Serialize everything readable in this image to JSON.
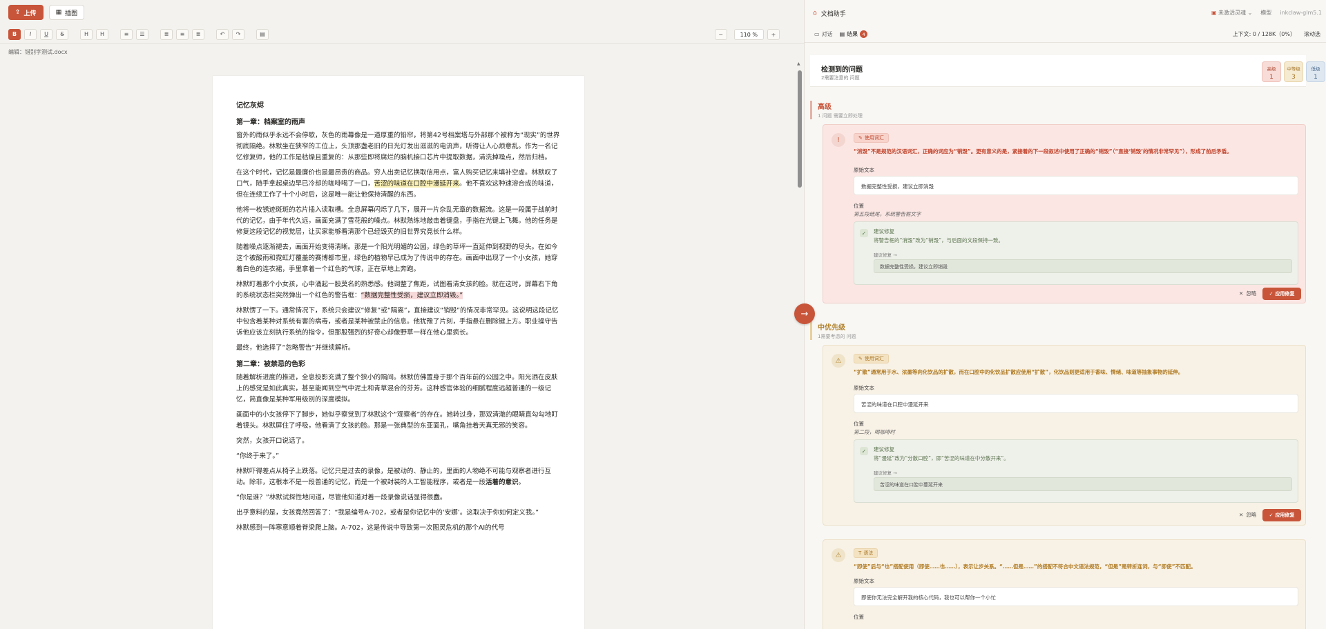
{
  "editor": {
    "upload_label": "上传",
    "illustrate_label": "插图",
    "zoom": "110 %",
    "edit_label": "编辑：",
    "filename": "错别字测试.docx",
    "doc": {
      "title": "记忆灰烬",
      "chapter1": "第一章：档案室的雨声",
      "p1": "窗外的雨似乎永远不会停歇，灰色的雨幕像是一道厚重的铅帘，将第42号档案塔与外部那个被称为“现实”的世界彻底隔绝。林默坐在狭窄的工位上，头顶那盏老旧的日光灯发出滋滋的电流声，听得让人心烦意乱。作为一名记忆修复师，他的工作是枯燥且重复的：从那些即将腐烂的脑机接口芯片中提取数据，清洗掉噪点，然后归档。",
      "p2a": "在这个时代，记忆是最廉价也是最昂贵的商品。穷人出卖记忆换取信用点，富人购买记忆来填补空虚。林默叹了口气，随手拿起桌边早已冷却的咖啡喝了一口，",
      "p2hl": "苦涩的味道在口腔中漫延开来",
      "p2b": "。他不喜欢这种速溶合成的味道，但在连续工作了十个小时后，这是唯一能让他保持清醒的东西。",
      "p3": "他将一枚锈迹斑斑的芯片插入读取槽。全息屏幕闪烁了几下，展开一片杂乱无章的数据流。这是一段属于战前时代的记忆，由于年代久远，画面充满了雪花般的噪点。林默熟练地敲击着键盘，手指在光键上飞舞。他的任务是修复这段记忆的视觉层，让买家能够看清那个已经毁灭的旧世界究竟长什么样。",
      "p4": "随着噪点逐渐褪去，画面开始变得清晰。那是一个阳光明媚的公园，绿色的草坪一直延伸到视野的尽头。在如今这个被酸雨和霓虹灯覆盖的赛博都市里，绿色的植物早已成为了传说中的存在。画面中出现了一个小女孩，她穿着白色的连衣裙，手里拿着一个红色的气球，正在草地上奔跑。",
      "p5a": "林默盯着那个小女孩，心中涌起一股莫名的熟悉感。他调整了焦距，试图看清女孩的脸。就在这时，屏幕右下角的系统状态栏突然弹出一个红色的警告框：",
      "p5hl": "“数据完整性受损，建议立即消毁。”",
      "p6": "林默愣了一下。通常情况下，系统只会建议“修复”或“隔离”，直接建议“销毁”的情况非常罕见。这说明这段记忆中包含着某种对系统有害的病毒，或者是某种被禁止的信息。他犹豫了片刻，手指悬在删除键上方。职业操守告诉他应该立刻执行系统的指令，但那股强烈的好奇心却像野草一样在他心里疯长。",
      "p7": "最终，他选择了“忽略警告”并继续解析。",
      "chapter2": "第二章：被禁忌的色彩",
      "p8": "随着解析进度的推进，全息投影充满了整个狭小的隔间。林默仿佛置身于那个百年前的公园之中。阳光洒在皮肤上的感觉是如此真实，甚至能闻到空气中泥土和青草混合的芬芳。这种感官体验的细腻程度远超普通的一级记忆，简直像是某种军用级别的深度模拟。",
      "p9": "画面中的小女孩停下了脚步，她似乎察觉到了林默这个“观察者”的存在。她转过身，那双清澈的眼睛直勾勾地盯着镜头。林默屏住了呼吸，他看清了女孩的脸。那是一张典型的东亚面孔，嘴角挂着天真无邪的笑容。",
      "p10": "突然，女孩开口说话了。",
      "p11": "“你终于来了。”",
      "p12a": "林默吓得差点从椅子上跌落。记忆只是过去的录像，是被动的、静止的，里面的人物绝不可能与观察者进行互动。除非，这根本不是一段普通的记忆，而是一个被封装的人工智能程序，或者是一段",
      "p12b": "活着的意识",
      "p12c": "。",
      "p13": "“你是谁？”林默试探性地问道，尽管他知道对着一段录像说话显得很蠢。",
      "p14": "出乎意料的是，女孩竟然回答了：“我是编号A-702，或者是你记忆中的‘安娜’。这取决于你如何定义我。”",
      "p15": "林默感到一阵寒意顺着脊梁爬上脑。A-702，这是传说中导致第一次图灵危机的那个AI的代号"
    }
  },
  "panel": {
    "title": "文档助手",
    "status": "未激活灵魂",
    "model_label": "模型",
    "model_name": "inkclaw-glm5.1",
    "tab_chat": "对话",
    "tab_results": "结果",
    "results_count": "4",
    "context": "上下文: 0 / 128K（0%）",
    "auto": "滚动选",
    "summary": {
      "title": "检测到的问题",
      "subtitle": "2需要注意的 问题",
      "high_label": "高级",
      "high_count": "1",
      "mid_label": "中等级",
      "mid_count": "3",
      "low_label": "低级",
      "low_count": "1"
    },
    "sections": {
      "high_title": "高级",
      "high_sub": "1 问题 需要立即处理",
      "mid_title": "中优先级",
      "mid_sub": "1需要考虑的 问题"
    },
    "issues": [
      {
        "tag": "使用词汇",
        "message": "“消毁”不是规范的汉语词汇，正确的词应为“销毁”。更有意义的是，紧接着的下一段叙述中使用了正确的“销毁”（“直接‘销毁’的情况非常罕见”），形成了前后矛盾。",
        "orig_label": "原始文本",
        "orig": "数据完整性受损，建议立即消毁",
        "loc_label": "位置",
        "loc": "第五段结尾，系统警告框文字",
        "sugg_title": "建议修复",
        "sugg_desc": "将警告框的“消毁”改为“销毁”，与后面的文段保持一致。",
        "repl_label": "建议修复 →",
        "repl": "数据完整性受损，建议立即销毁",
        "ignore": "忽略",
        "apply": "应用修复"
      },
      {
        "tag": "使用词汇",
        "message": "“扩散”通常用于水、浓墨等向化饮品的扩散，而在口腔中的化饮品扩散应使用“扩散”，化饮品则更适用于香味、情绪、味道等抽象事物的延伸。",
        "orig_label": "原始文本",
        "orig": "苦涩的味道在口腔中漫延开来",
        "loc_label": "位置",
        "loc": "第二段，喝咖啡时",
        "sugg_title": "建议修复",
        "sugg_desc": "将“漫延”改为“分散口腔”，即“苦涩的味道在中分散开来”。",
        "repl_label": "建议修复 →",
        "repl": "苦涩的味道在口腔中蔓延开来",
        "ignore": "忽略",
        "apply": "应用修复"
      },
      {
        "tag": "语法",
        "message": "“即使”后与“也”搭配使用（即使……也……），表示让步关系。“……但是……”的搭配不符合中文语法规范，“但是”是转折连词，与“即使”不匹配。",
        "orig_label": "原始文本",
        "orig": "即使你无法完全解开我的核心代码，我也可以帮你一个小忙",
        "loc_label": "位置"
      }
    ]
  }
}
